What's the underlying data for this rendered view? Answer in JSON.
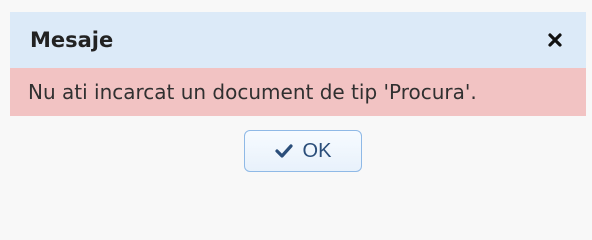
{
  "dialog": {
    "title": "Mesaje",
    "close_icon": "close-icon",
    "message": "Nu ati incarcat un document de tip 'Procura'.",
    "ok_button": {
      "label": "OK",
      "icon": "check-icon"
    }
  },
  "colors": {
    "titlebar": "#dceaf8",
    "message_bar": "#f2c3c3",
    "content_bg": "#f8f8f8",
    "ok_border": "#8fb9e6",
    "ok_text": "#2b4e7a"
  }
}
